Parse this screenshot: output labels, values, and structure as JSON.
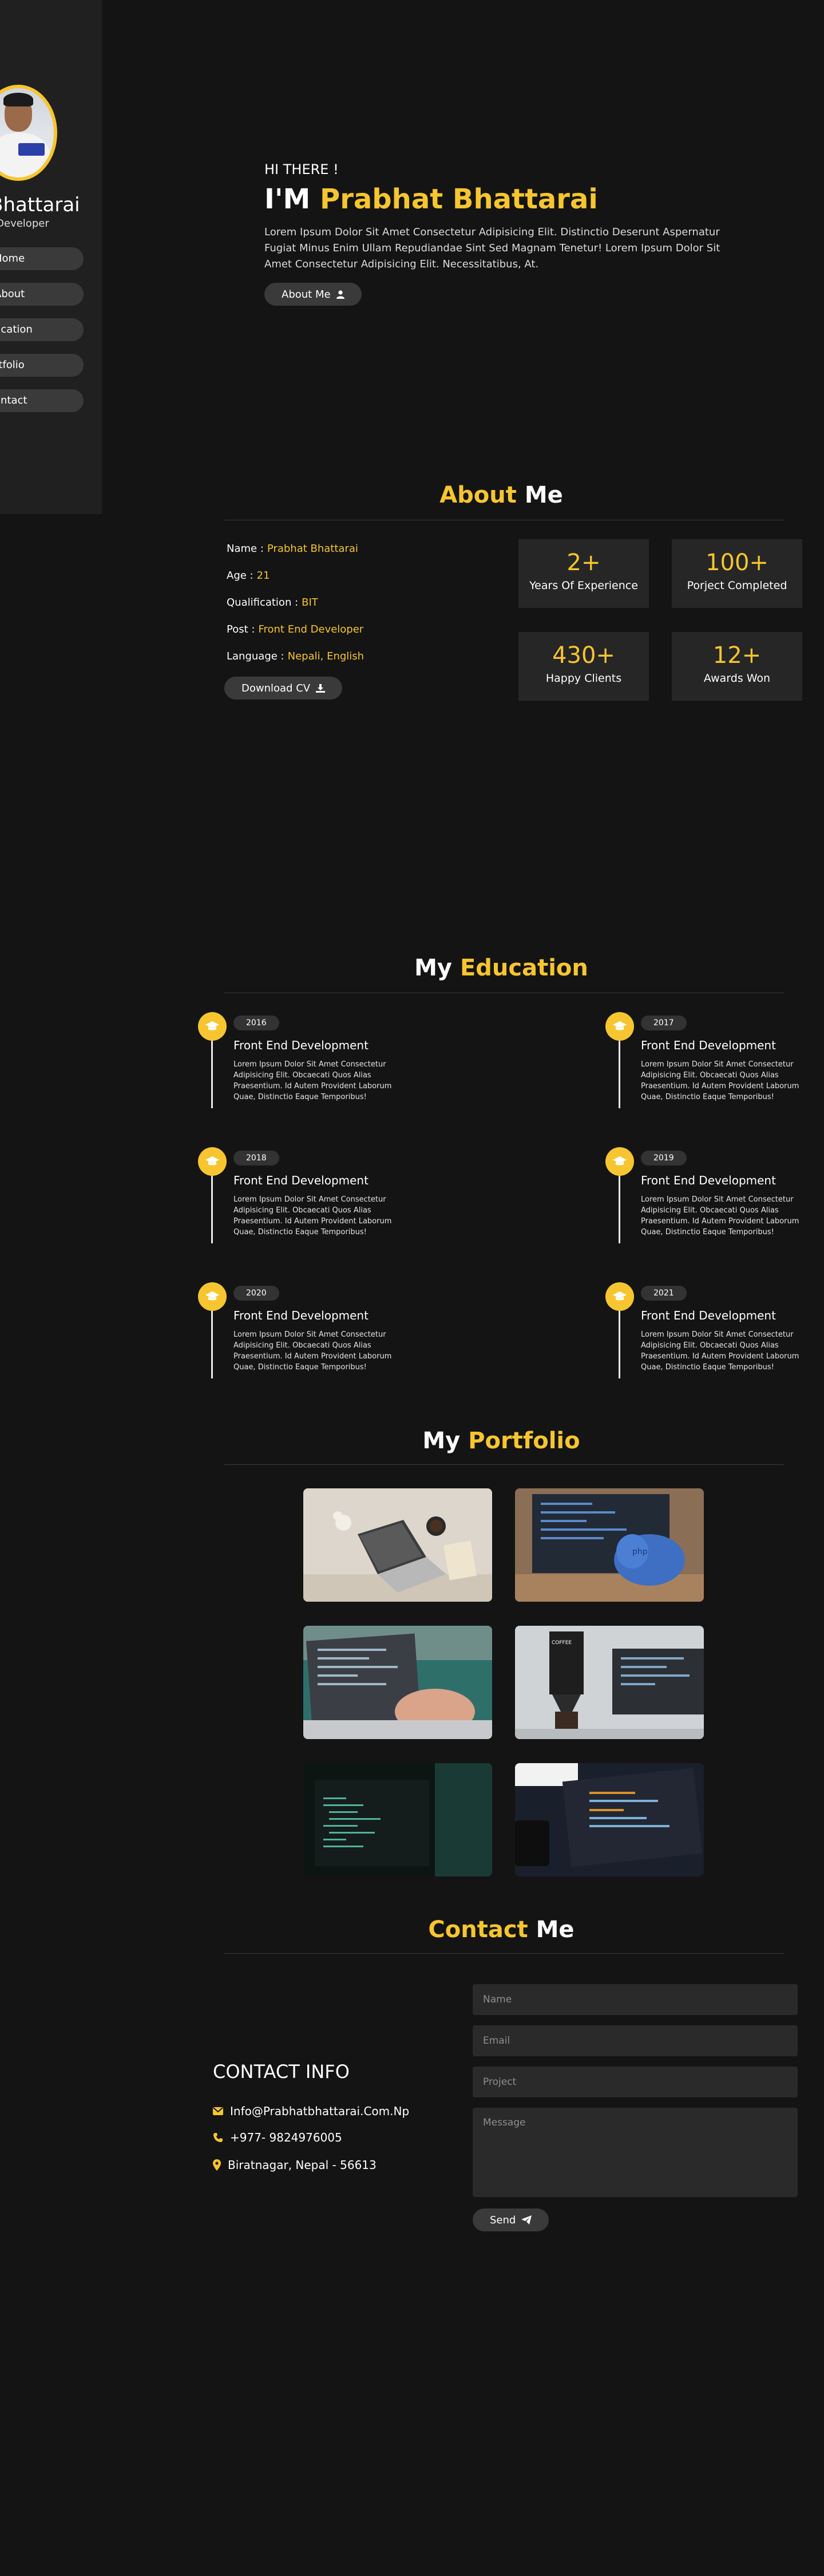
{
  "colors": {
    "accent": "#f7c52f",
    "background": "#141414",
    "sidebar": "#202020",
    "card": "#262626",
    "pill": "#3a3a3a"
  },
  "sidebar": {
    "name": "t Bhattarai",
    "role": "d Developer",
    "nav": [
      {
        "label": "Home"
      },
      {
        "label": "About"
      },
      {
        "label": "ucation"
      },
      {
        "label": "rtfolio"
      },
      {
        "label": "ontact"
      }
    ]
  },
  "hero": {
    "greeting": "HI THERE !",
    "title_prefix": "I'M",
    "title_name": "Prabhat Bhattarai",
    "description": "Lorem Ipsum Dolor Sit Amet Consectetur Adipisicing Elit. Distinctio Deserunt Aspernatur Fugiat Minus Enim Ullam Repudiandae Sint Sed Magnam Tenetur! Lorem Ipsum Dolor Sit Amet Consectetur Adipisicing Elit. Necessitatibus, At.",
    "button_label": "About Me",
    "button_icon": "user-icon"
  },
  "about": {
    "title_accent": "About",
    "title_rest": "Me",
    "info": [
      {
        "label": "Name :",
        "value": "Prabhat Bhattarai"
      },
      {
        "label": "Age :",
        "value": "21"
      },
      {
        "label": "Qualification :",
        "value": "BIT"
      },
      {
        "label": "Post :",
        "value": "Front End Developer"
      },
      {
        "label": "Language :",
        "value": "Nepali, English"
      }
    ],
    "download_label": "Download CV",
    "download_icon": "download-icon",
    "stats": [
      {
        "number": "2+",
        "label": "Years Of Experience"
      },
      {
        "number": "100+",
        "label": "Porject Completed"
      },
      {
        "number": "430+",
        "label": "Happy Clients"
      },
      {
        "number": "12+",
        "label": "Awards Won"
      }
    ]
  },
  "education": {
    "title_rest": "My",
    "title_accent": "Education",
    "icon": "graduation-cap-icon",
    "items": [
      {
        "year": "2016",
        "title": "Front End Development",
        "desc": "Lorem Ipsum Dolor Sit Amet Consectetur Adipisicing Elit. Obcaecati Quos Alias Praesentium. Id Autem Provident Laborum Quae, Distinctio Eaque Temporibus!"
      },
      {
        "year": "2017",
        "title": "Front End Development",
        "desc": "Lorem Ipsum Dolor Sit Amet Consectetur Adipisicing Elit. Obcaecati Quos Alias Praesentium. Id Autem Provident Laborum Quae, Distinctio Eaque Temporibus!"
      },
      {
        "year": "2018",
        "title": "Front End Development",
        "desc": "Lorem Ipsum Dolor Sit Amet Consectetur Adipisicing Elit. Obcaecati Quos Alias Praesentium. Id Autem Provident Laborum Quae, Distinctio Eaque Temporibus!"
      },
      {
        "year": "2019",
        "title": "Front End Development",
        "desc": "Lorem Ipsum Dolor Sit Amet Consectetur Adipisicing Elit. Obcaecati Quos Alias Praesentium. Id Autem Provident Laborum Quae, Distinctio Eaque Temporibus!"
      },
      {
        "year": "2020",
        "title": "Front End Development",
        "desc": "Lorem Ipsum Dolor Sit Amet Consectetur Adipisicing Elit. Obcaecati Quos Alias Praesentium. Id Autem Provident Laborum Quae, Distinctio Eaque Temporibus!"
      },
      {
        "year": "2021",
        "title": "Front End Development",
        "desc": "Lorem Ipsum Dolor Sit Amet Consectetur Adipisicing Elit. Obcaecati Quos Alias Praesentium. Id Autem Provident Laborum Quae, Distinctio Eaque Temporibus!"
      }
    ]
  },
  "portfolio": {
    "title_rest": "My",
    "title_accent": "Portfolio"
  },
  "contact": {
    "title_accent": "Contact",
    "title_rest": "Me",
    "info_heading": "CONTACT INFO",
    "lines": [
      {
        "icon": "envelope-icon",
        "text": "Info@Prabhatbhattarai.Com.Np"
      },
      {
        "icon": "phone-icon",
        "text": "+977- 9824976005"
      },
      {
        "icon": "map-marker-icon",
        "text": "Biratnagar, Nepal - 56613"
      }
    ],
    "placeholders": {
      "name": "Name",
      "email": "Email",
      "project": "Project",
      "message": "Message"
    },
    "send_label": "Send",
    "send_icon": "paper-plane-icon"
  }
}
